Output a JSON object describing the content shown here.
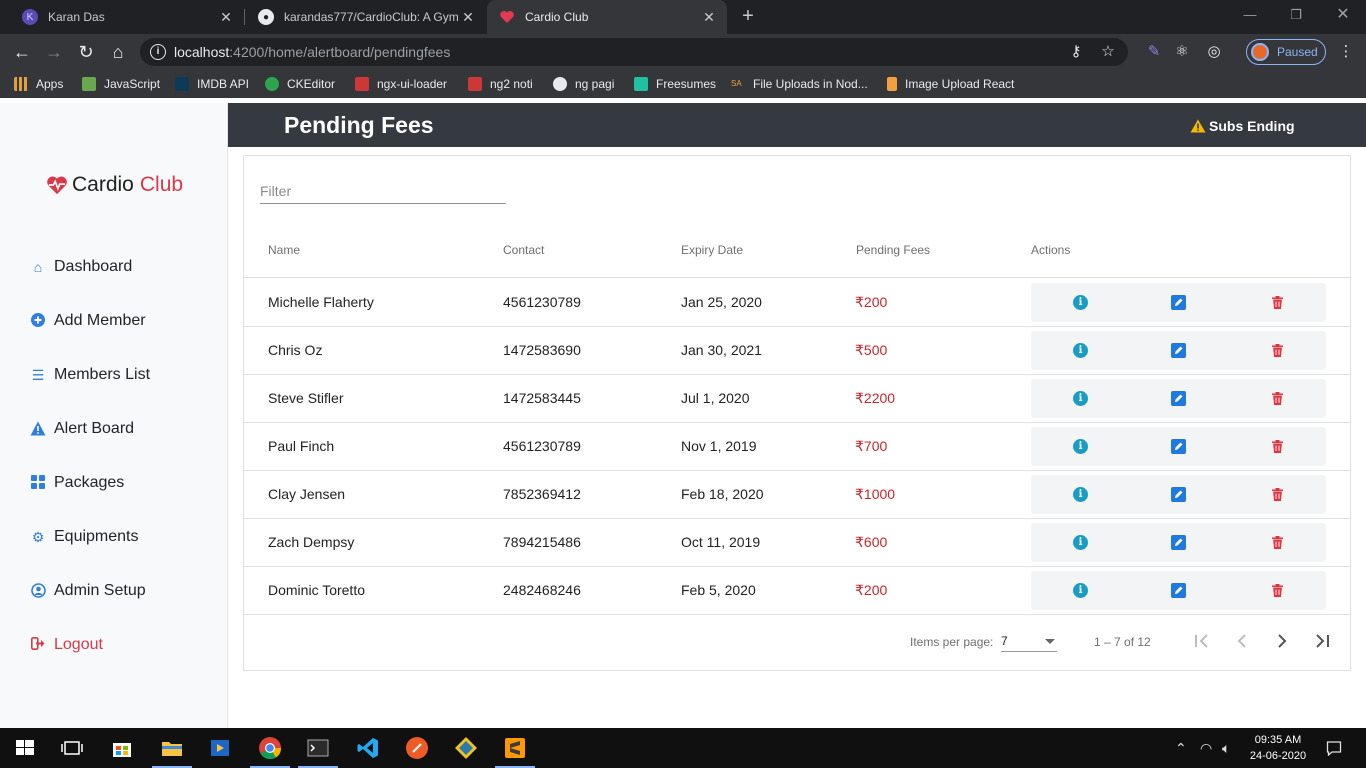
{
  "browser": {
    "tabs": [
      {
        "label": "Karan Das",
        "icon": "karan-das-icon",
        "active": false
      },
      {
        "label": "karandas777/CardioClub: A Gym",
        "icon": "github-icon",
        "active": false
      },
      {
        "label": "Cardio Club",
        "icon": "heart-icon",
        "active": true
      }
    ],
    "url": {
      "host": "localhost",
      "path": ":4200/home/alertboard/pendingfees"
    },
    "profile_status": "Paused",
    "bookmarks": [
      {
        "label": "Apps",
        "icon": "apps-grid-icon"
      },
      {
        "label": "JavaScript",
        "icon": "bookmark-js-icon"
      },
      {
        "label": "IMDB API",
        "icon": "bookmark-imdb-icon"
      },
      {
        "label": "CKEditor",
        "icon": "bookmark-ckeditor-icon"
      },
      {
        "label": "ngx-ui-loader",
        "icon": "bookmark-npm-icon"
      },
      {
        "label": "ng2 noti",
        "icon": "bookmark-npm-icon"
      },
      {
        "label": "ng pagi",
        "icon": "bookmark-globe-icon"
      },
      {
        "label": "Freesumes",
        "icon": "bookmark-freesumes-icon"
      },
      {
        "label": "File Uploads in Nod...",
        "icon": "bookmark-sa-icon"
      },
      {
        "label": "Image Upload React",
        "icon": "bookmark-ribbon-icon"
      }
    ]
  },
  "app": {
    "brand": {
      "part1": "Cardio",
      "part2": "Club"
    },
    "nav": [
      {
        "label": "Dashboard",
        "icon": "home-icon"
      },
      {
        "label": "Add Member",
        "icon": "plus-circle-icon"
      },
      {
        "label": "Members List",
        "icon": "list-icon"
      },
      {
        "label": "Alert Board",
        "icon": "warning-icon"
      },
      {
        "label": "Packages",
        "icon": "grid-icon"
      },
      {
        "label": "Equipments",
        "icon": "gear-icon"
      },
      {
        "label": "Admin Setup",
        "icon": "user-circle-icon"
      },
      {
        "label": "Logout",
        "icon": "logout-icon"
      }
    ],
    "header": {
      "title": "Pending Fees",
      "alert_label": "Subs Ending"
    },
    "filter_placeholder": "Filter",
    "table": {
      "columns": [
        "Name",
        "Contact",
        "Expiry Date",
        "Pending Fees",
        "Actions"
      ],
      "currency_symbol": "₹",
      "rows": [
        {
          "name": "Michelle Flaherty",
          "contact": "4561230789",
          "expiry": "Jan 25, 2020",
          "fees": "200"
        },
        {
          "name": "Chris Oz",
          "contact": "1472583690",
          "expiry": "Jan 30, 2021",
          "fees": "500"
        },
        {
          "name": "Steve Stifler",
          "contact": "1472583445",
          "expiry": "Jul 1, 2020",
          "fees": "2200"
        },
        {
          "name": "Paul Finch",
          "contact": "4561230789",
          "expiry": "Nov 1, 2019",
          "fees": "700"
        },
        {
          "name": "Clay Jensen",
          "contact": "7852369412",
          "expiry": "Feb 18, 2020",
          "fees": "1000"
        },
        {
          "name": "Zach Dempsy",
          "contact": "7894215486",
          "expiry": "Oct 11, 2019",
          "fees": "600"
        },
        {
          "name": "Dominic Toretto",
          "contact": "2482468246",
          "expiry": "Feb 5, 2020",
          "fees": "200"
        }
      ]
    },
    "paginator": {
      "items_per_page_label": "Items per page:",
      "page_size": "7",
      "range_label": "1 – 7 of 12"
    }
  },
  "taskbar": {
    "time": "09:35 AM",
    "date": "24-06-2020"
  },
  "colors": {
    "accent_blue": "#2f7fe0",
    "brand_red": "#d93a4a",
    "header_dark": "#343a40",
    "fee_red": "#c9252c",
    "info_teal": "#1a9cc4"
  }
}
